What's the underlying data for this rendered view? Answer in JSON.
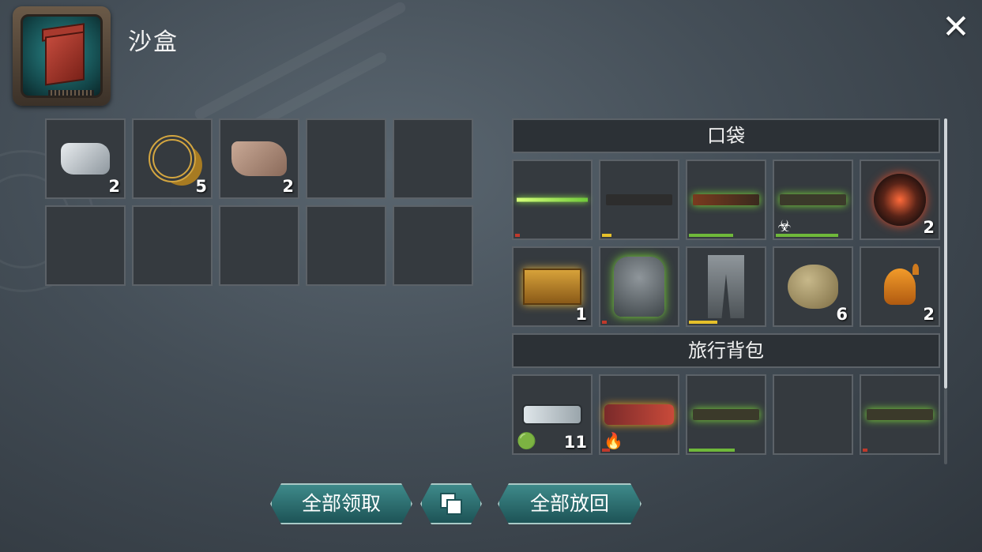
{
  "header": {
    "title": "沙盒",
    "close_symbol": "✕"
  },
  "container": {
    "slots": [
      {
        "icon": "metal-ingot-icon",
        "count": "2"
      },
      {
        "icon": "gold-jewelry-icon",
        "count": "5"
      },
      {
        "icon": "cloth-icon",
        "count": "2"
      },
      {
        "icon": "",
        "count": ""
      },
      {
        "icon": "",
        "count": ""
      },
      {
        "icon": "",
        "count": ""
      },
      {
        "icon": "",
        "count": ""
      },
      {
        "icon": "",
        "count": ""
      },
      {
        "icon": "",
        "count": ""
      },
      {
        "icon": "",
        "count": ""
      }
    ]
  },
  "pocket": {
    "label": "口袋",
    "slots": [
      {
        "icon": "katana-icon",
        "count": "",
        "durability": 0.06,
        "dura_color": "#c0392b"
      },
      {
        "icon": "m16-rifle-icon",
        "count": "",
        "durability": 0.12,
        "dura_color": "#e6c02a"
      },
      {
        "icon": "hunting-rifle-icon",
        "count": "",
        "durability": 0.58,
        "dura_color": "#6fb83a"
      },
      {
        "icon": "ak-rifle-icon",
        "count": "",
        "durability": 0.82,
        "dura_color": "#6fb83a",
        "badge": "☣"
      },
      {
        "icon": "spiked-mine-icon",
        "count": "2"
      },
      {
        "icon": "toolbox-icon",
        "count": "1"
      },
      {
        "icon": "armor-jacket-icon",
        "count": "",
        "durability": 0.06,
        "dura_color": "#c0392b"
      },
      {
        "icon": "armor-pants-icon",
        "count": "",
        "durability": 0.38,
        "dura_color": "#e6c02a"
      },
      {
        "icon": "canteen-icon",
        "count": "6"
      },
      {
        "icon": "oil-can-icon",
        "count": "2"
      }
    ]
  },
  "backpack": {
    "label": "旅行背包",
    "slots": [
      {
        "icon": "syringe-icon",
        "count": "11",
        "badge": "🟢"
      },
      {
        "icon": "flame-launcher-icon",
        "count": "",
        "durability": 0.1,
        "dura_color": "#c0392b",
        "badge": "🔥"
      },
      {
        "icon": "ak-rifle-icon",
        "count": "",
        "durability": 0.6,
        "dura_color": "#6fb83a"
      },
      {
        "icon": "",
        "count": ""
      },
      {
        "icon": "assault-rifle-icon",
        "count": "",
        "durability": 0.06,
        "dura_color": "#c0392b"
      }
    ]
  },
  "buttons": {
    "take_all": "全部领取",
    "put_all": "全部放回"
  }
}
